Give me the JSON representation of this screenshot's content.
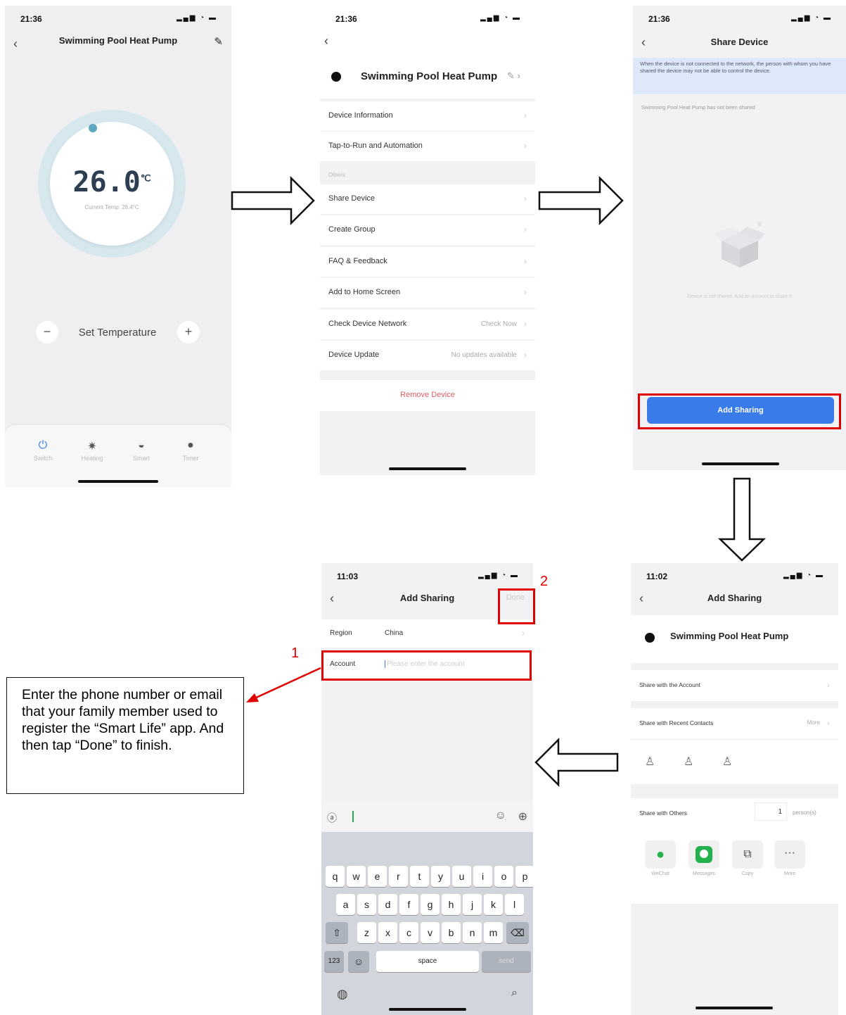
{
  "colors": {
    "accent": "#3a7bea",
    "callout_red": "#e00000",
    "teal": "#5fa8bf",
    "remove_red": "#e06060"
  },
  "screen1": {
    "status_time": "21:36",
    "title": "Swimming Pool Heat Pump",
    "temperature": "26.0",
    "temp_unit": "℃",
    "current_temp": "Current Temp: 28.4°C",
    "minus": "−",
    "plus": "+",
    "set_temp_label": "Set Temperature",
    "tabs": [
      {
        "label": "Switch",
        "icon": "power-icon"
      },
      {
        "label": "Heating",
        "icon": "sun-icon"
      },
      {
        "label": "Smart",
        "icon": "smart-icon"
      },
      {
        "label": "Timer",
        "icon": "clock-icon"
      }
    ]
  },
  "screen2": {
    "status_time": "21:36",
    "device_name": "Swimming Pool Heat Pump",
    "items": [
      {
        "label": "Device Information"
      },
      {
        "label": "Tap-to-Run and Automation"
      },
      {
        "label": "Share Device"
      },
      {
        "label": "Create Group"
      },
      {
        "label": "FAQ & Feedback"
      },
      {
        "label": "Add to Home Screen"
      },
      {
        "label": "Check Device Network",
        "value": "Check Now"
      },
      {
        "label": "Device Update",
        "value": "No updates available"
      }
    ],
    "section_others": "Others",
    "remove": "Remove Device"
  },
  "screen3": {
    "status_time": "21:36",
    "title": "Share Device",
    "notice": "When the device is not connected to the network, the person with whom you have shared the device may not be able to control the device.",
    "not_shared": "Swimming Pool Heat Pump has not been shared",
    "empty_text": "Device is not shared. Add an account to share it",
    "add_button": "Add Sharing"
  },
  "screen4": {
    "status_time": "11:02",
    "title": "Add Sharing",
    "device_name": "Swimming Pool Heat Pump",
    "share_account": "Share with the Account",
    "share_recent": "Share with Recent Contacts",
    "more": "More",
    "share_others": "Share with Others",
    "count": "1",
    "persons": "person(s)",
    "apps": [
      "WeChat",
      "Messages",
      "Copy",
      "More"
    ]
  },
  "screen5": {
    "status_time": "11:03",
    "title": "Add Sharing",
    "done": "Done",
    "region_label": "Region",
    "region_value": "China",
    "account_label": "Account",
    "account_placeholder": "Please enter the account",
    "keyboard_rows": [
      [
        "q",
        "w",
        "e",
        "r",
        "t",
        "y",
        "u",
        "i",
        "o",
        "p"
      ],
      [
        "a",
        "s",
        "d",
        "f",
        "g",
        "h",
        "j",
        "k",
        "l"
      ],
      [
        "z",
        "x",
        "c",
        "v",
        "b",
        "n",
        "m"
      ]
    ],
    "key_123": "123",
    "key_space": "space",
    "key_send": "send"
  },
  "callouts": {
    "num1": "1",
    "num2": "2",
    "instruction": "Enter the phone number or email that your family member used to register the “Smart Life” app. And then tap “Done” to finish."
  }
}
